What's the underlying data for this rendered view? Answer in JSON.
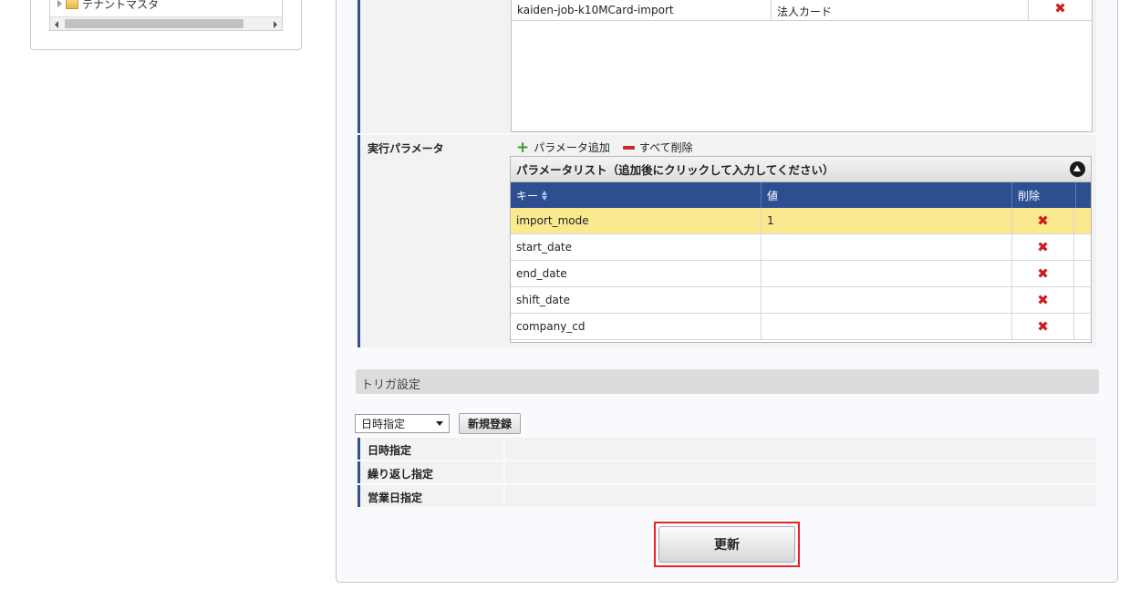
{
  "tree": {
    "items": [
      {
        "label": "テナントマスタ"
      }
    ]
  },
  "jobs": {
    "rows": [
      {
        "job_id": "kaiden-job-k10MCard-import",
        "name": "法人カード"
      }
    ]
  },
  "params": {
    "label": "実行パラメータ",
    "add_label": "パラメータ追加",
    "delete_all_label": "すべて削除",
    "list_title": "パラメータリスト（追加後にクリックして入力してください）",
    "columns": {
      "key": "キー",
      "value": "値",
      "delete": "削除"
    },
    "rows": [
      {
        "key": "import_mode",
        "value": "1"
      },
      {
        "key": "start_date",
        "value": ""
      },
      {
        "key": "end_date",
        "value": ""
      },
      {
        "key": "shift_date",
        "value": ""
      },
      {
        "key": "company_cd",
        "value": ""
      }
    ]
  },
  "trigger": {
    "section_title": "トリガ設定",
    "select_value": "日時指定",
    "register_label": "新規登録",
    "rows": [
      {
        "label": "日時指定"
      },
      {
        "label": "繰り返し指定"
      },
      {
        "label": "営業日指定"
      }
    ]
  },
  "actions": {
    "update_label": "更新"
  },
  "colors": {
    "accent_blue": "#2d4f92",
    "highlight_row": "#fbe98f",
    "delete_red": "#cc1f1f",
    "focus_border": "#e8232a"
  }
}
